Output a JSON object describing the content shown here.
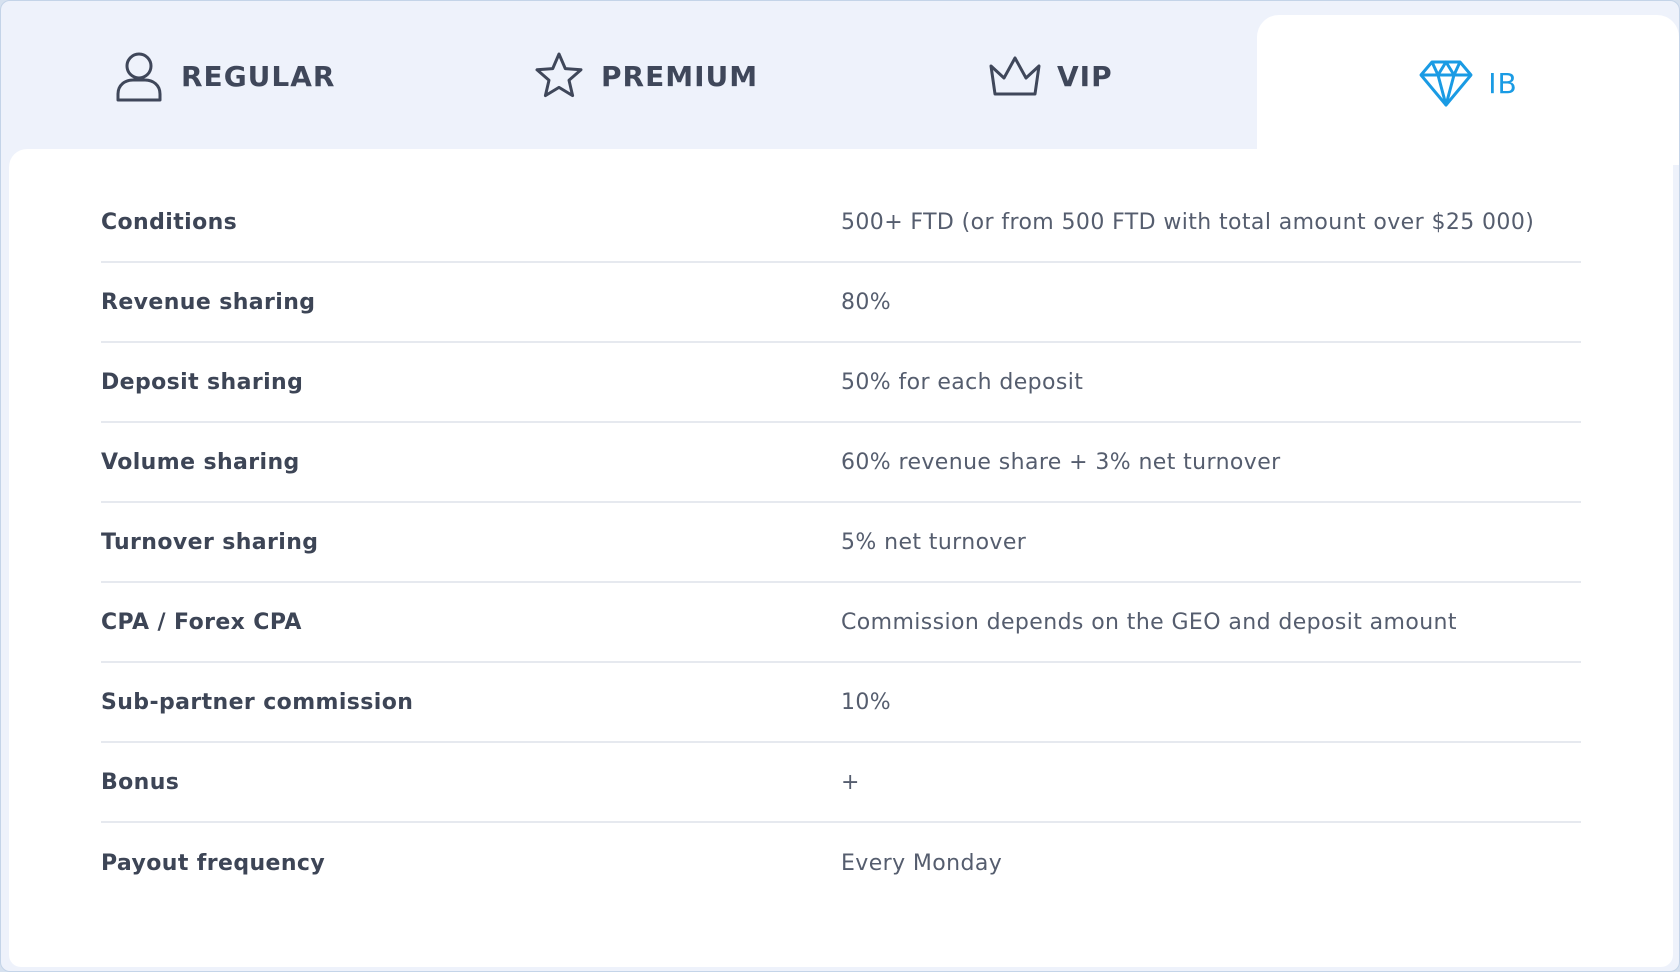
{
  "tabs": [
    {
      "label": "REGULAR",
      "icon": "user-icon"
    },
    {
      "label": "PREMIUM",
      "icon": "star-icon"
    },
    {
      "label": "VIP",
      "icon": "crown-icon"
    },
    {
      "label": "IB",
      "icon": "diamond-icon",
      "active": true
    }
  ],
  "colors": {
    "active_tab_text": "#1a9be4",
    "inactive_tab_text": "#3f475a",
    "tab_bar_background": "#eef2fb",
    "panel_background": "#ffffff"
  },
  "table": {
    "rows": [
      {
        "label": "Conditions",
        "value": "500+ FTD (or from 500 FTD with total amount over $25 000)"
      },
      {
        "label": "Revenue sharing",
        "value": "80%"
      },
      {
        "label": "Deposit sharing",
        "value": "50% for each deposit"
      },
      {
        "label": "Volume sharing",
        "value": "60% revenue share + 3% net turnover"
      },
      {
        "label": "Turnover sharing",
        "value": "5% net turnover"
      },
      {
        "label": "CPA / Forex CPA",
        "value": "Commission depends on the GEO and deposit amount"
      },
      {
        "label": "Sub-partner commission",
        "value": "10%"
      },
      {
        "label": "Bonus",
        "value": "+"
      },
      {
        "label": "Payout frequency",
        "value": "Every Monday"
      }
    ]
  }
}
